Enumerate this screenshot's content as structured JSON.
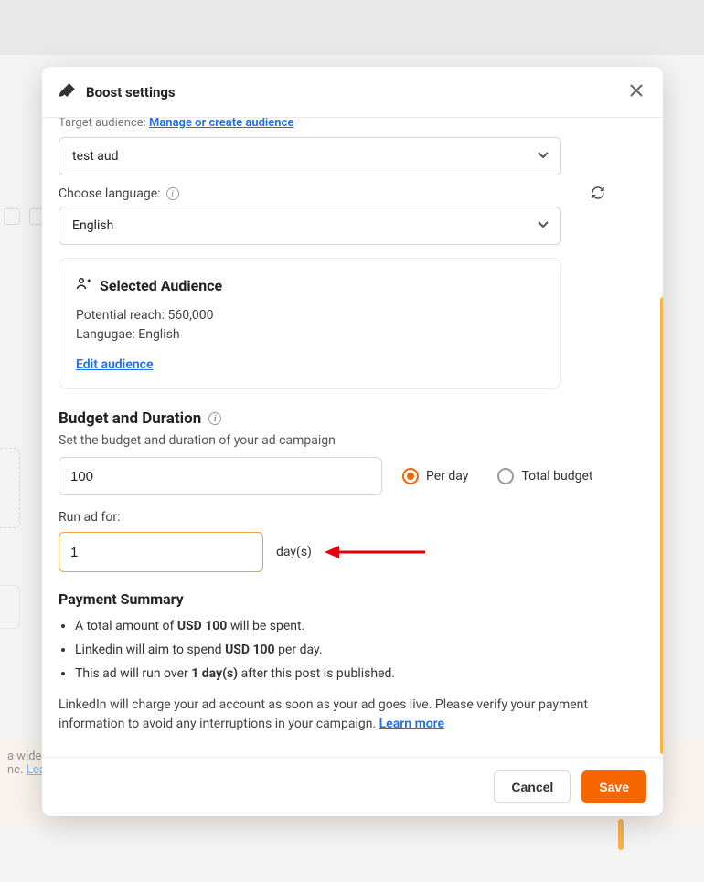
{
  "background": {
    "banner_text1": "a wider",
    "banner_text2": "ne.",
    "banner_link": "Lea"
  },
  "modal": {
    "title": "Boost settings",
    "target_audience_label": "Target audience:",
    "manage_link": "Manage or create audience",
    "audience_select_value": "test aud",
    "choose_language_label": "Choose language:",
    "language_select_value": "English",
    "selected_audience": {
      "title": "Selected Audience",
      "reach_label": "Potential reach:",
      "reach_value": "560,000",
      "lang_label": "Langugae:",
      "lang_value": "English",
      "edit_link": "Edit audience"
    },
    "budget": {
      "section_title": "Budget and Duration",
      "section_desc": "Set the budget and duration of your ad campaign",
      "amount_value": "100",
      "per_day_label": "Per day",
      "total_budget_label": "Total budget",
      "run_for_label": "Run ad for:",
      "duration_value": "1",
      "days_suffix": "day(s)"
    },
    "summary": {
      "title": "Payment Summary",
      "line1_pre": "A total amount of ",
      "line1_bold": "USD 100",
      "line1_post": " will be spent.",
      "line2_pre": "Linkedin will aim to spend ",
      "line2_bold": "USD 100",
      "line2_post": " per day.",
      "line3_pre": "This ad will run over ",
      "line3_bold": "1 day(s)",
      "line3_post": " after this post is published.",
      "fineprint": "LinkedIn will charge your ad account as soon as your ad goes live. Please verify your payment information to avoid any interruptions in your campaign. ",
      "learn_more": "Learn more"
    },
    "footer": {
      "cancel": "Cancel",
      "save": "Save"
    }
  }
}
